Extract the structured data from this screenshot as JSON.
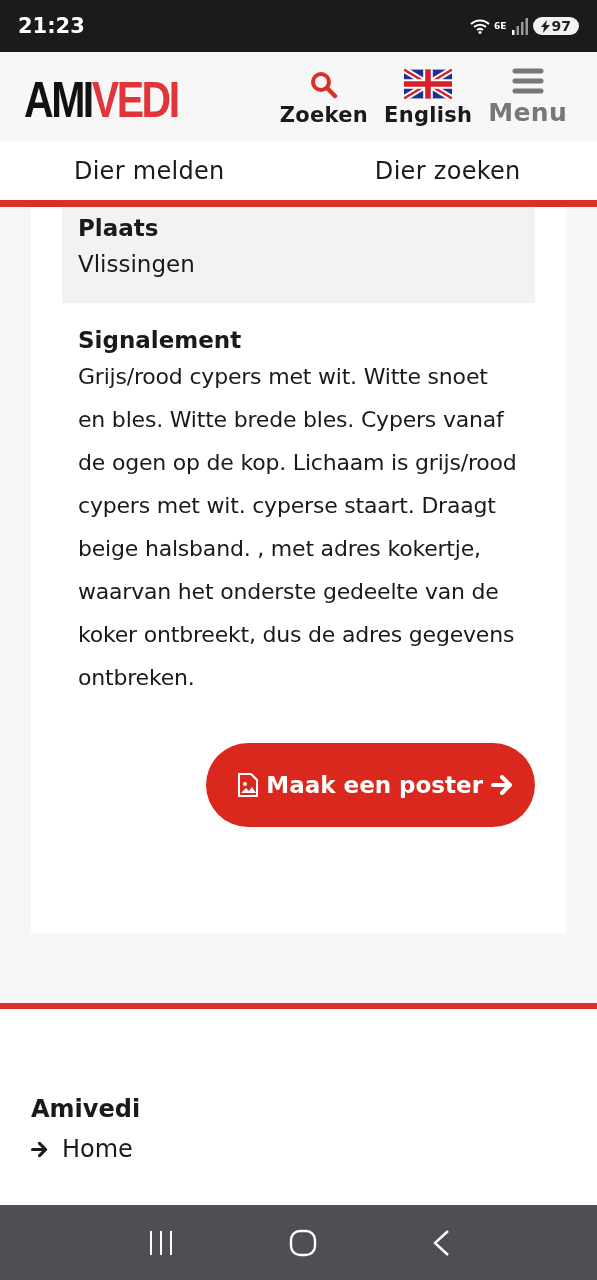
{
  "status_bar": {
    "time": "21:23",
    "network": "6E",
    "battery": "97"
  },
  "header": {
    "logo": [
      {
        "text": "AMI",
        "kind": "dark"
      },
      {
        "text": "VEDI",
        "kind": "accent"
      }
    ],
    "actions": [
      {
        "label": "Zoeken",
        "kind": "search"
      },
      {
        "label": "English",
        "kind": "flag"
      },
      {
        "label": "Menu",
        "kind": "menu"
      }
    ]
  },
  "nav": {
    "items": [
      {
        "label": "Dier melden"
      },
      {
        "label": "Dier zoeken"
      }
    ]
  },
  "details": {
    "place": {
      "label": "Plaats",
      "value": "Vlissingen"
    },
    "description": {
      "label": "Signalement",
      "text": "Grijs/rood cypers met wit. Witte snoet en bles. Witte brede bles. Cypers vanaf de ogen op de kop. Lichaam is grijs/rood cypers met wit. cyperse staart. Draagt beige halsband. , met adres kokertje, waarvan het onderste gedeelte van de koker ontbreekt, dus de adres gegevens ontbreken."
    },
    "poster_button": {
      "label": "Maak een poster"
    }
  },
  "footer": {
    "heading": "Amivedi",
    "links": [
      {
        "label": "Home"
      }
    ]
  }
}
